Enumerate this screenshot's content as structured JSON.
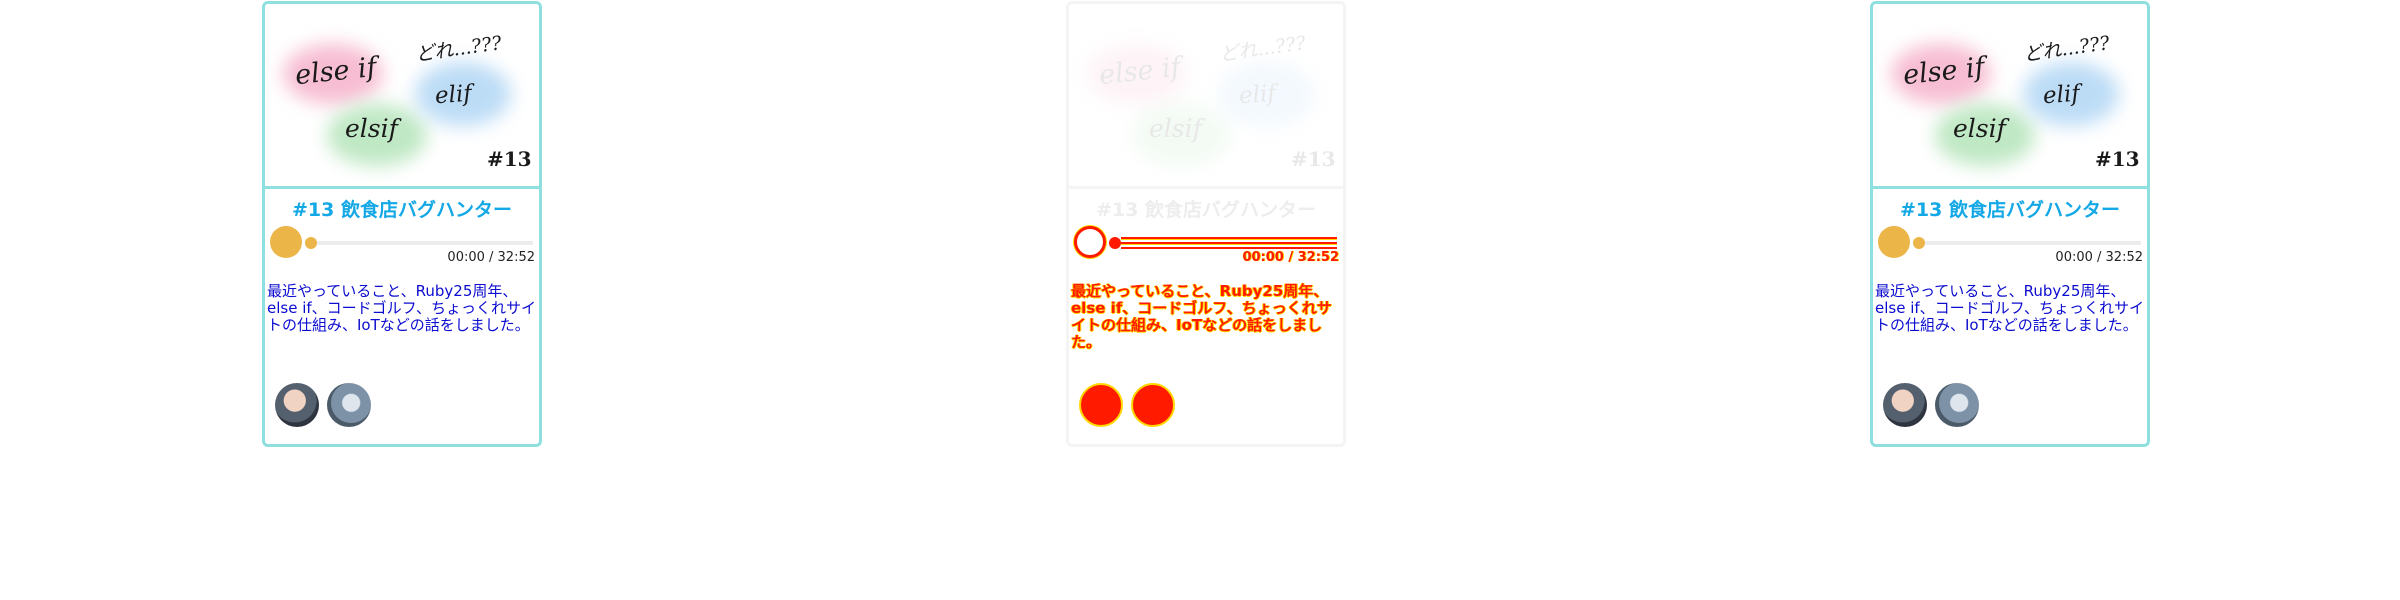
{
  "cards": [
    {
      "artwork": {
        "label_else_if": "else if",
        "label_elsif": "elsif",
        "label_elif": "elif",
        "label_question": "どれ...???",
        "label_number": "#13"
      },
      "title": "#13 飲食店バグハンター",
      "player": {
        "time": "00:00 / 32:52",
        "progress": 0
      },
      "description": "最近やっていること、Ruby25周年、else if、コードゴルフ、ちょっくれサイトの仕組み、IoTなどの話をしました。",
      "avatars": [
        "host-avatar-1",
        "host-avatar-2"
      ]
    },
    {
      "artwork": {
        "label_else_if": "else if",
        "label_elsif": "elsif",
        "label_elif": "elif",
        "label_question": "どれ...???",
        "label_number": "#13"
      },
      "title": "#13 飲食店バグハンター",
      "player": {
        "time": "00:00 / 32:52",
        "progress": 0
      },
      "description": "最近やっていること、Ruby25周年、else if、コードゴルフ、ちょっくれサイトの仕組み、IoTなどの話をしました。",
      "avatars": [
        "host-avatar-1",
        "host-avatar-2"
      ]
    },
    {
      "artwork": {
        "label_else_if": "else if",
        "label_elsif": "elsif",
        "label_elif": "elif",
        "label_question": "どれ...???",
        "label_number": "#13"
      },
      "title": "#13 飲食店バグハンター",
      "player": {
        "time": "00:00 / 32:52",
        "progress": 0
      },
      "description": "最近やっていること、Ruby25周年、else if、コードゴルフ、ちょっくれサイトの仕組み、IoTなどの話をしました。",
      "avatars": [
        "host-avatar-1",
        "host-avatar-2"
      ]
    }
  ],
  "colors": {
    "card_border": "#8ee0e0",
    "title": "#14a8e6",
    "description": "#0c0cd0",
    "player_accent": "#ebb548",
    "glitch_red": "#ff1a00",
    "glitch_yellow": "#ffd800"
  }
}
